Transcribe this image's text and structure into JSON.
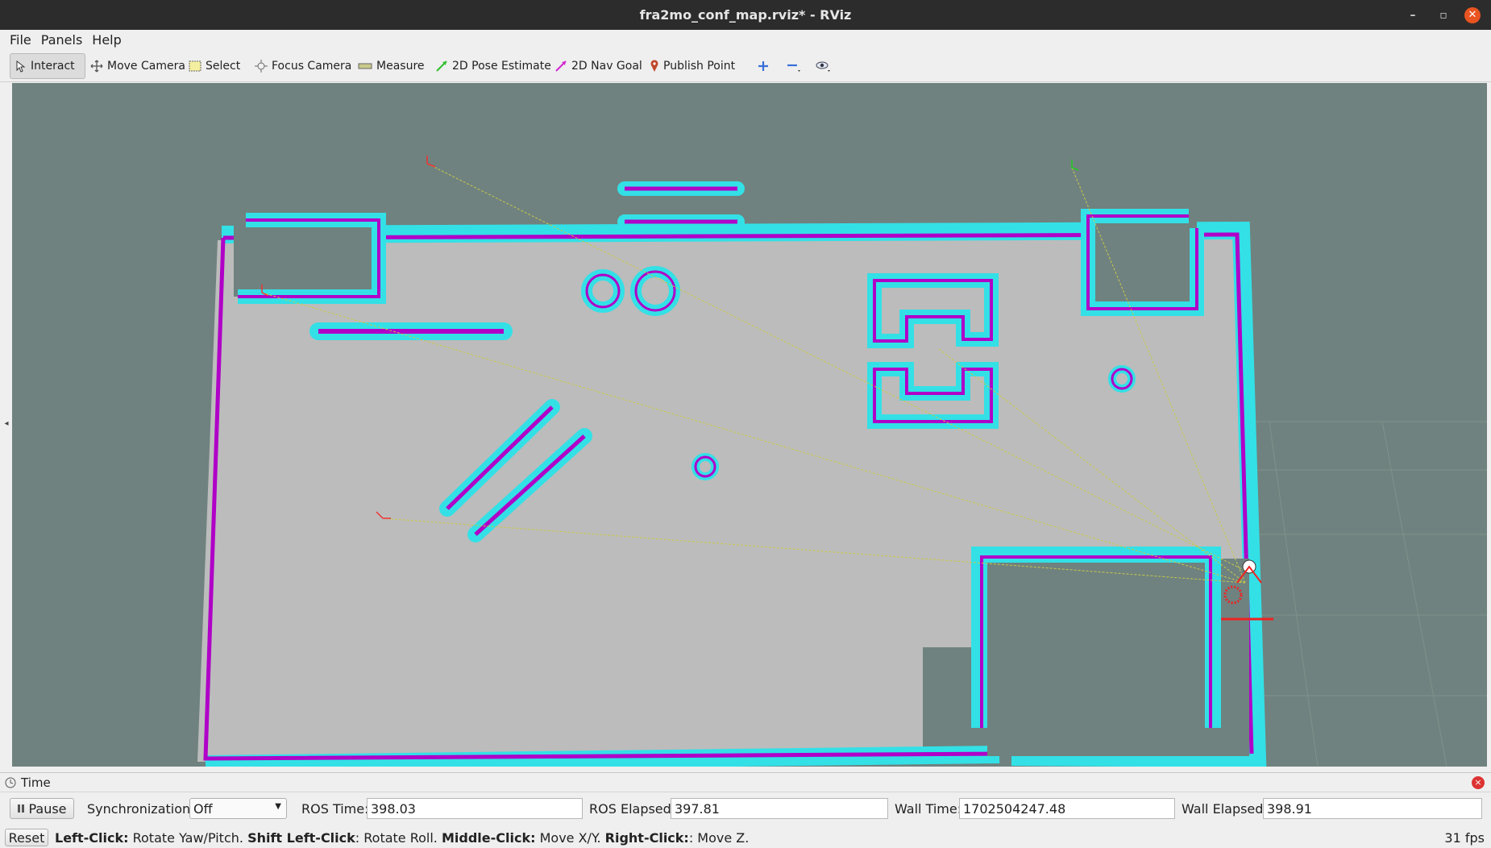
{
  "window": {
    "title": "fra2mo_conf_map.rviz* - RViz",
    "controls": [
      "–",
      "▫",
      "✕"
    ]
  },
  "menubar": {
    "items": [
      {
        "label": "File"
      },
      {
        "label": "Panels"
      },
      {
        "label": "Help"
      }
    ]
  },
  "toolbar": {
    "tools": [
      {
        "label": "Interact",
        "icon": "cursor-icon",
        "active": true
      },
      {
        "label": "Move Camera",
        "icon": "move-icon"
      },
      {
        "label": "Select",
        "icon": "select-box-icon"
      },
      {
        "label": "Focus Camera",
        "icon": "focus-icon"
      },
      {
        "label": "Measure",
        "icon": "ruler-icon"
      },
      {
        "label": "2D Pose Estimate",
        "icon": "green-arrow-icon"
      },
      {
        "label": "2D Nav Goal",
        "icon": "pink-arrow-icon"
      },
      {
        "label": "Publish Point",
        "icon": "map-pin-icon"
      }
    ],
    "extra_icons": [
      "plus-icon",
      "minus-icon",
      "eye-icon"
    ]
  },
  "viewport": {
    "background": "#6f827f",
    "colors": {
      "wall_cyan": "#33e0e6",
      "wall_magenta": "#b000c8",
      "free_space": "#bdbdbd",
      "unknown": "#6f827f",
      "path": "#c8c84a"
    }
  },
  "time_panel": {
    "title": "Time",
    "pause_label": "Pause",
    "sync_label": "Synchronization:",
    "sync_value": "Off",
    "ros_time_label": "ROS Time:",
    "ros_time": "398.03",
    "ros_elapsed_label": "ROS Elapsed:",
    "ros_elapsed": "397.81",
    "wall_time_label": "Wall Time:",
    "wall_time": "1702504247.48",
    "wall_elapsed_label": "Wall Elapsed:",
    "wall_elapsed": "398.91"
  },
  "statusbar": {
    "reset_label": "Reset",
    "hint_parts": [
      {
        "bold": "Left-Click:",
        "text": " Rotate Yaw/Pitch. "
      },
      {
        "bold": "Shift Left-Click",
        "text": ": Rotate Roll. "
      },
      {
        "bold": "Middle-Click:",
        "text": " Move X/Y. "
      },
      {
        "bold": "Right-Click:",
        "text": ": Move Z."
      }
    ],
    "fps": "31 fps"
  }
}
